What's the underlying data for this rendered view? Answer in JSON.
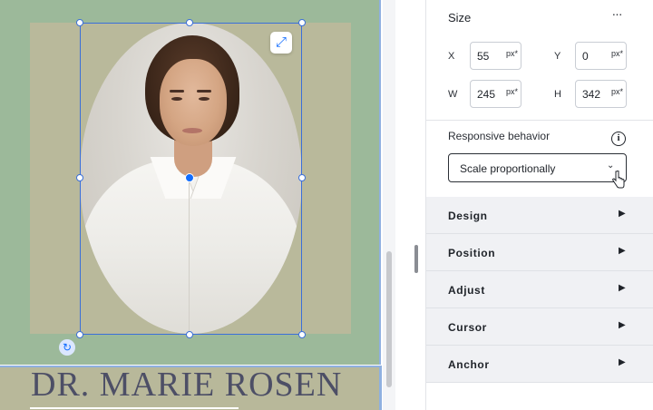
{
  "canvas": {
    "title": "DR. MARIE ROSEN",
    "expand_icon": "expand-arrows-icon",
    "rotate_icon": "rotate-icon"
  },
  "panel": {
    "size_heading": "Size",
    "more_label": "···",
    "fields": {
      "x": {
        "label": "X",
        "value": "55",
        "unit": "px*"
      },
      "y": {
        "label": "Y",
        "value": "0",
        "unit": "px*"
      },
      "w": {
        "label": "W",
        "value": "245",
        "unit": "px*"
      },
      "h": {
        "label": "H",
        "value": "342",
        "unit": "px*"
      }
    },
    "responsive_label": "Responsive behavior",
    "info_glyph": "i",
    "responsive_value": "Scale proportionally",
    "sections": [
      {
        "label": "Design"
      },
      {
        "label": "Position"
      },
      {
        "label": "Adjust"
      },
      {
        "label": "Cursor"
      },
      {
        "label": "Anchor"
      }
    ]
  },
  "colors": {
    "selection": "#116dff",
    "section_bg": "#9cb99a",
    "frame_bg": "#b9b99b",
    "title_color": "#4d4f66"
  }
}
